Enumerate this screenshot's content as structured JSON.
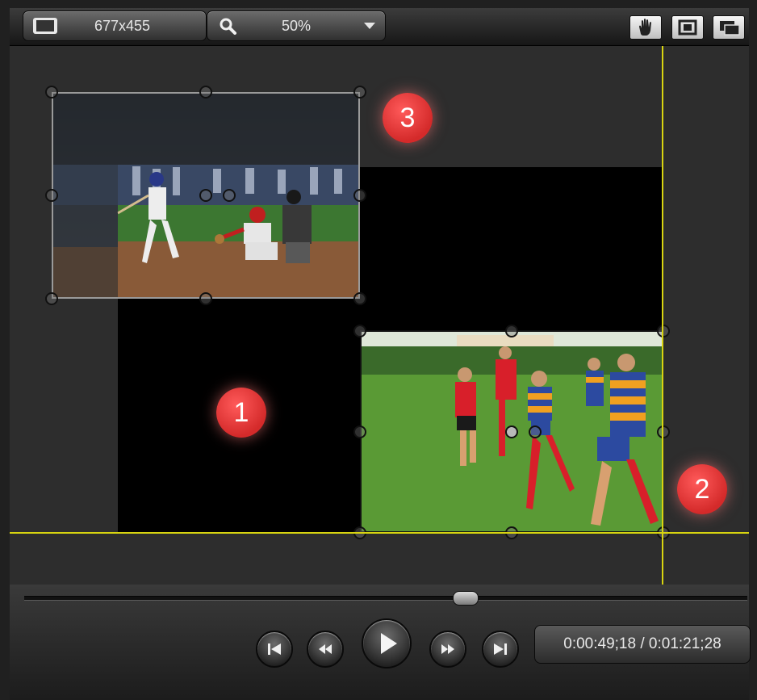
{
  "toolbar": {
    "dimensions_label": "677x455",
    "zoom_value": "50%",
    "icons": [
      "resize-icon",
      "search-icon",
      "dropdown-arrow-icon",
      "hand-pan-icon",
      "fit-screen-icon",
      "detach-window-icon"
    ]
  },
  "canvas": {
    "guide_color": "#d8d410",
    "badges": [
      {
        "number": "1"
      },
      {
        "number": "2"
      },
      {
        "number": "3"
      }
    ],
    "clips": [
      {
        "name": "baseball-clip"
      },
      {
        "name": "rugby-clip"
      }
    ]
  },
  "player": {
    "timecode": "0:00:49;18 / 0:01:21;28",
    "progress_fraction": 0.61,
    "controls": [
      "skip-to-start-icon",
      "rewind-icon",
      "play-icon",
      "fast-forward-icon",
      "skip-to-end-icon"
    ]
  },
  "colors": {
    "badge": "#e03a3a",
    "guide": "#d8d410",
    "background": "#2d2d2d"
  }
}
